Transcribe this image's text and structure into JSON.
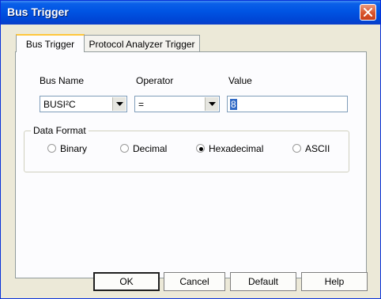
{
  "window": {
    "title": "Bus Trigger"
  },
  "tabs": [
    {
      "label": "Bus Trigger",
      "active": true
    },
    {
      "label": "Protocol Analyzer Trigger",
      "active": false
    }
  ],
  "form": {
    "bus_name_label": "Bus Name",
    "operator_label": "Operator",
    "value_label": "Value",
    "bus_name_value": "BUSI²C",
    "operator_value": "=",
    "value_value": "8"
  },
  "data_format": {
    "legend": "Data Format",
    "options": [
      {
        "label": "Binary",
        "selected": false
      },
      {
        "label": "Decimal",
        "selected": false
      },
      {
        "label": "Hexadecimal",
        "selected": true
      },
      {
        "label": "ASCII",
        "selected": false
      }
    ]
  },
  "buttons": {
    "ok": "OK",
    "cancel": "Cancel",
    "default": "Default",
    "help": "Help"
  },
  "colors": {
    "titlebar": "#0054e3",
    "close_button": "#d9542c",
    "selection": "#316ac5",
    "dialog_bg": "#ece9d8"
  }
}
